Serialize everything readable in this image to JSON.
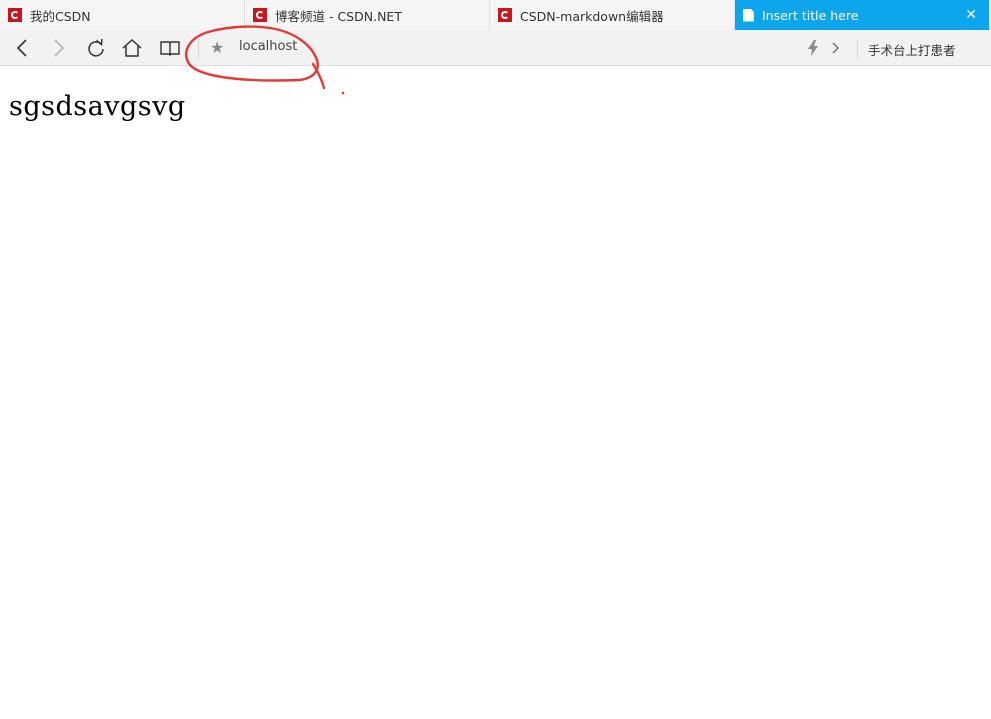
{
  "tabs": [
    {
      "title": "我的CSDN",
      "icon": "csdn-logo-icon"
    },
    {
      "title": "博客频道 - CSDN.NET",
      "icon": "csdn-logo-icon"
    },
    {
      "title": "CSDN-markdown编辑器",
      "icon": "csdn-logo-icon"
    },
    {
      "title": "Insert title here",
      "icon": "page-icon",
      "active": true,
      "close_glyph": "✕"
    }
  ],
  "toolbar": {
    "back_icon": "back-icon",
    "forward_icon": "forward-icon",
    "reload_icon": "reload-icon",
    "home_icon": "home-icon",
    "reader_icon": "reader-icon",
    "star_glyph": "★",
    "address": "localhost",
    "bolt_icon": "lightning-icon",
    "chevron_icon": "chevron-right-icon",
    "side_text": "手术台上打患者"
  },
  "page": {
    "text": "sgsdsavgsvg"
  },
  "colors": {
    "active_tab": "#0da6ed",
    "csdn_red": "#c8161d",
    "annotation_red": "#e53935"
  }
}
